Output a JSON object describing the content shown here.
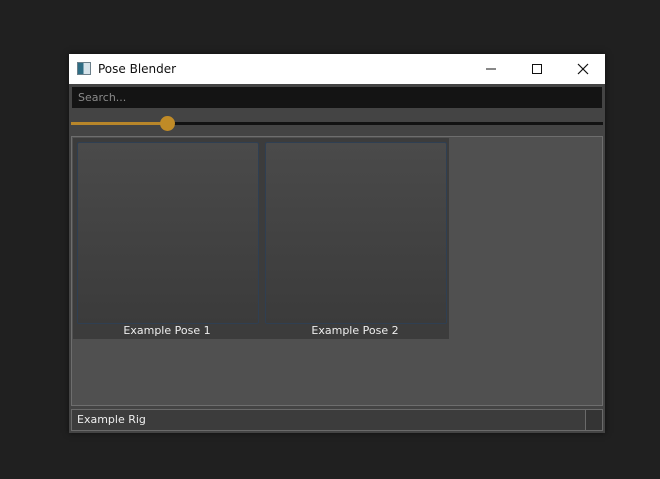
{
  "window": {
    "title": "Pose Blender",
    "icon": "app-icon"
  },
  "controls": {
    "minimize": "minimize-icon",
    "maximize": "maximize-icon",
    "close": "close-icon"
  },
  "search": {
    "placeholder": "Search...",
    "value": ""
  },
  "size_slider": {
    "value_fraction": 0.18,
    "accent_color": "#c08b27"
  },
  "poses": [
    {
      "label": "Example Pose 1"
    },
    {
      "label": "Example Pose 2"
    }
  ],
  "rig_selector": {
    "selected": "Example Rig"
  }
}
